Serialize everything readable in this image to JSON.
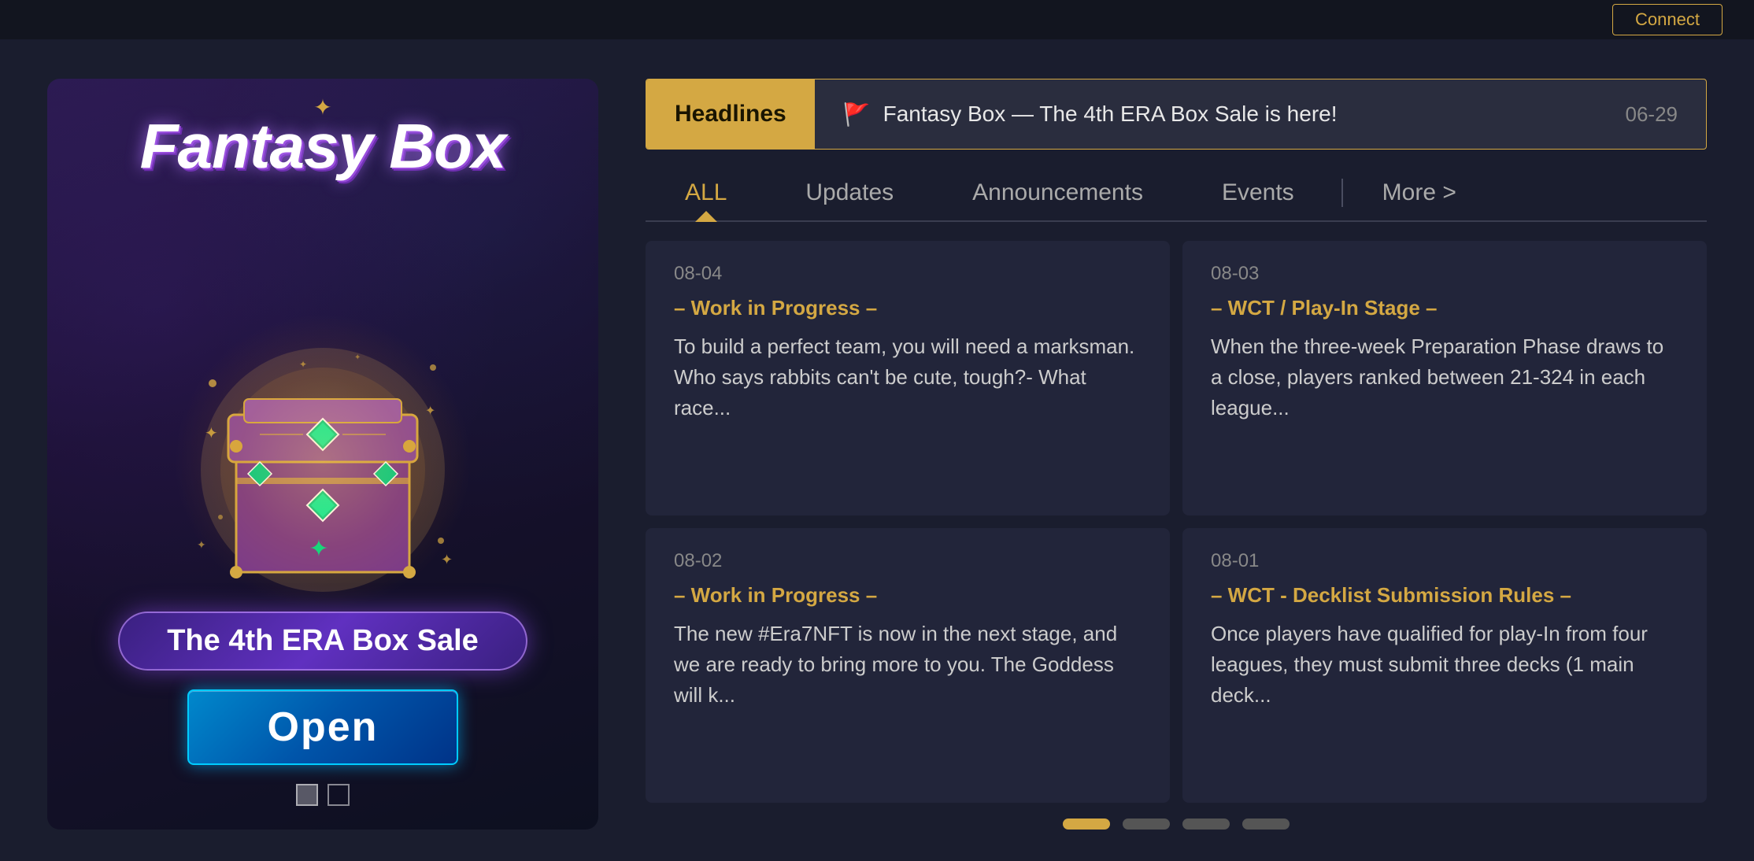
{
  "topBar": {
    "buttonLabel": "Connect"
  },
  "leftPanel": {
    "title": "Fantasy Box",
    "subtitle": "The 4th ERA Box Sale",
    "openButton": "Open"
  },
  "headlines": {
    "label": "Headlines",
    "text": "Fantasy Box — The 4th ERA Box Sale is here!",
    "date": "06-29"
  },
  "tabs": [
    {
      "id": "all",
      "label": "ALL",
      "active": true
    },
    {
      "id": "updates",
      "label": "Updates",
      "active": false
    },
    {
      "id": "announcements",
      "label": "Announcements",
      "active": false
    },
    {
      "id": "events",
      "label": "Events",
      "active": false
    },
    {
      "id": "more",
      "label": "More >",
      "active": false
    }
  ],
  "newsCards": [
    {
      "date": "08-04",
      "category": "– Work in Progress –",
      "excerpt": "To build a perfect team, you will need a marksman. Who says rabbits can't be cute, tough?- What race..."
    },
    {
      "date": "08-03",
      "category": "– WCT / Play-In Stage –",
      "excerpt": "When the three-week Preparation Phase draws to a close, players ranked between 21-324 in each league..."
    },
    {
      "date": "08-02",
      "category": "– Work in Progress –",
      "excerpt": "The new #Era7NFT is now in the next stage, and we are ready to bring more to you. The Goddess will k..."
    },
    {
      "date": "08-01",
      "category": "– WCT - Decklist Submission Rules –",
      "excerpt": "Once players have qualified for play-In from four leagues, they must submit three decks (1 main deck..."
    }
  ],
  "pagination": {
    "dots": [
      {
        "active": true
      },
      {
        "active": false
      },
      {
        "active": false
      },
      {
        "active": false
      }
    ]
  }
}
